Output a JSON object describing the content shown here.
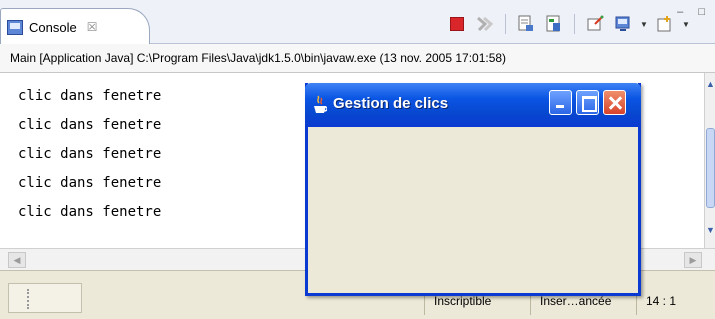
{
  "console_view": {
    "tab_label": "Console",
    "tab_close_glyph": "☒",
    "launch_info": "Main [Application Java] C:\\Program Files\\Java\\jdk1.5.0\\bin\\javaw.exe (13 nov. 2005 17:01:58)",
    "output_lines": [
      "clic dans fenetre",
      "clic dans fenetre",
      "clic dans fenetre",
      "clic dans fenetre",
      "clic dans fenetre"
    ],
    "toolbar_icons": [
      "terminate-icon",
      "remove-launches-icon",
      "clear-console-icon",
      "scroll-lock-icon",
      "pin-console-icon",
      "display-console-icon",
      "open-console-icon"
    ],
    "view_controls": "– □"
  },
  "status_bar": {
    "mode": "Inscriptible",
    "insert_mode": "Inser…ancée",
    "position": "14 : 1"
  },
  "dialog": {
    "title": "Gestion de clics"
  },
  "colors": {
    "titlebar": "#0a55e3",
    "close_button": "#d8432b",
    "terminate": "#d9262b"
  }
}
